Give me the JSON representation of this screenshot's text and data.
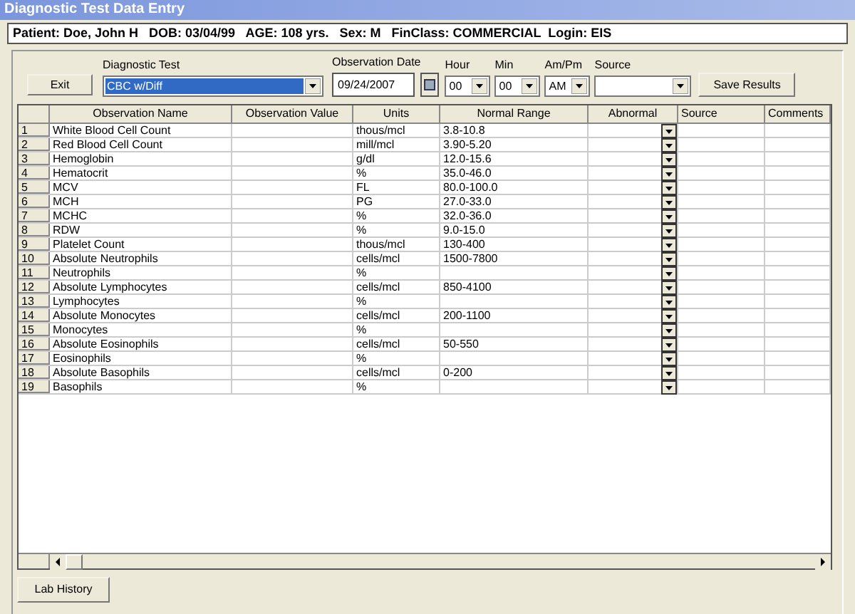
{
  "window": {
    "title": "Diagnostic Test Data Entry"
  },
  "patient_bar": "Patient: Doe, John H   DOB: 03/04/99   AGE: 108 yrs.   Sex: M   FinClass: COMMERCIAL  Login: EIS",
  "toolbar": {
    "exit_button": "Exit",
    "diagnostic_test": {
      "label": "Diagnostic Test",
      "value": "CBC w/Diff"
    },
    "observation_date": {
      "label": "Observation Date",
      "value": "09/24/2007"
    },
    "hour": {
      "label": "Hour",
      "value": "00"
    },
    "min": {
      "label": "Min",
      "value": "00"
    },
    "ampm": {
      "label": "Am/Pm",
      "value": "AM"
    },
    "source": {
      "label": "Source"
    },
    "save_button": "Save Results"
  },
  "table": {
    "columns": [
      "Observation Name",
      "Observation Value",
      "Units",
      "Normal Range",
      "Abnormal",
      "Source",
      "Comments"
    ],
    "rows": [
      {
        "number": "1",
        "name": "White Blood Cell Count",
        "units": "thous/mcl",
        "range": "3.8-10.8"
      },
      {
        "number": "2",
        "name": "Red Blood Cell Count",
        "units": "mill/mcl",
        "range": "3.90-5.20"
      },
      {
        "number": "3",
        "name": "Hemoglobin",
        "units": "g/dl",
        "range": "12.0-15.6"
      },
      {
        "number": "4",
        "name": "Hematocrit",
        "units": "%",
        "range": "35.0-46.0"
      },
      {
        "number": "5",
        "name": "MCV",
        "units": "FL",
        "range": "80.0-100.0"
      },
      {
        "number": "6",
        "name": "MCH",
        "units": "PG",
        "range": "27.0-33.0"
      },
      {
        "number": "7",
        "name": "MCHC",
        "units": "%",
        "range": "32.0-36.0"
      },
      {
        "number": "8",
        "name": "RDW",
        "units": "%",
        "range": "9.0-15.0"
      },
      {
        "number": "9",
        "name": "Platelet Count",
        "units": "thous/mcl",
        "range": "130-400"
      },
      {
        "number": "10",
        "name": "Absolute Neutrophils",
        "units": "cells/mcl",
        "range": "1500-7800"
      },
      {
        "number": "11",
        "name": "Neutrophils",
        "units": "%"
      },
      {
        "number": "12",
        "name": "Absolute Lymphocytes",
        "units": "cells/mcl",
        "range": "850-4100"
      },
      {
        "number": "13",
        "name": "Lymphocytes",
        "units": "%"
      },
      {
        "number": "14",
        "name": "Absolute Monocytes",
        "units": "cells/mcl",
        "range": "200-1100"
      },
      {
        "number": "15",
        "name": "Monocytes",
        "units": "%"
      },
      {
        "number": "16",
        "name": "Absolute Eosinophils",
        "units": "cells/mcl",
        "range": "50-550"
      },
      {
        "number": "17",
        "name": "Eosinophils",
        "units": "%"
      },
      {
        "number": "18",
        "name": "Absolute Basophils",
        "units": "cells/mcl",
        "range": "0-200"
      },
      {
        "number": "19",
        "name": "Basophils",
        "units": "%"
      }
    ]
  },
  "lab_history_button": "Lab History"
}
